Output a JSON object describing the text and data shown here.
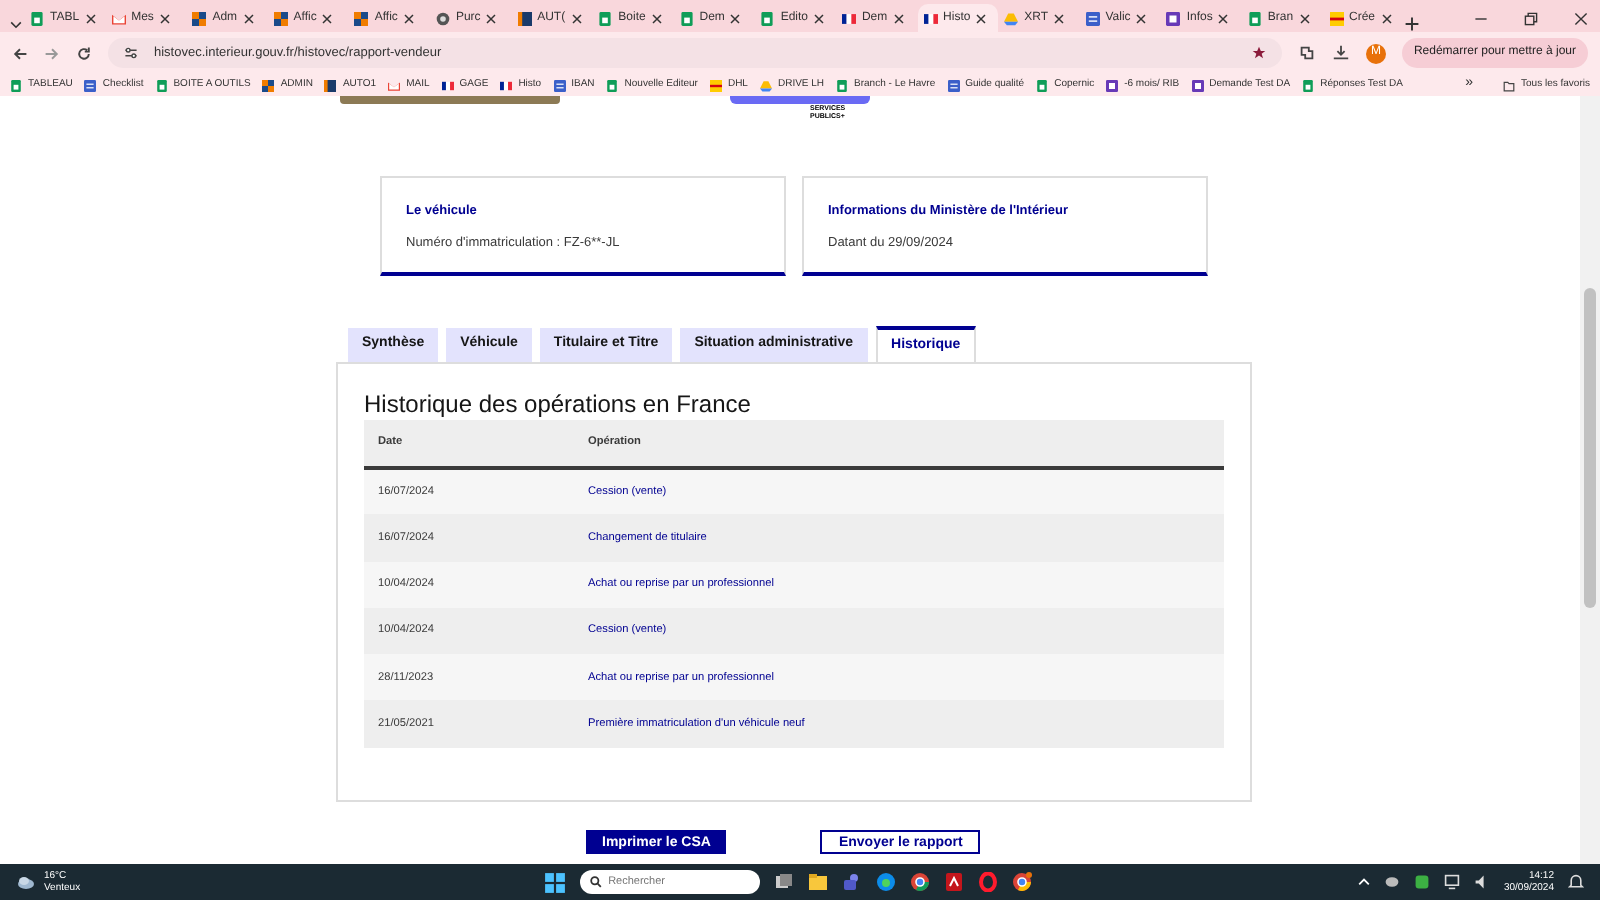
{
  "browser": {
    "tabs": [
      {
        "label": "TABL",
        "kind": "sheets",
        "selected": false
      },
      {
        "label": "Mes",
        "kind": "gmail",
        "selected": false
      },
      {
        "label": "Adm",
        "kind": "orange",
        "selected": false
      },
      {
        "label": "Affic",
        "kind": "orange",
        "selected": false
      },
      {
        "label": "Affic",
        "kind": "orange",
        "selected": false
      },
      {
        "label": "Purc",
        "kind": "globe",
        "selected": false
      },
      {
        "label": "AUT(",
        "kind": "auto",
        "selected": false
      },
      {
        "label": "Boite",
        "kind": "sheets",
        "selected": false
      },
      {
        "label": "Dem",
        "kind": "sheets",
        "selected": false
      },
      {
        "label": "Edito",
        "kind": "sheets",
        "selected": false
      },
      {
        "label": "Dem",
        "kind": "flag",
        "selected": false
      },
      {
        "label": "Histo",
        "kind": "flag",
        "selected": true
      },
      {
        "label": "XRT",
        "kind": "drive",
        "selected": false
      },
      {
        "label": "Valic",
        "kind": "blue",
        "selected": false
      },
      {
        "label": "Infos",
        "kind": "purple",
        "selected": false
      },
      {
        "label": "Bran",
        "kind": "sheets",
        "selected": false
      },
      {
        "label": "Crée",
        "kind": "yellow",
        "selected": false
      }
    ],
    "url": "histovec.interieur.gouv.fr/histovec/rapport-vendeur",
    "avatar": "M",
    "update_button": "Redémarrer pour mettre à jour",
    "bookmarks": [
      {
        "label": "TABLEAU",
        "kind": "sheets"
      },
      {
        "label": "Checklist",
        "kind": "blue"
      },
      {
        "label": "BOITE A OUTILS",
        "kind": "sheets"
      },
      {
        "label": "ADMIN",
        "kind": "orange"
      },
      {
        "label": "AUTO1",
        "kind": "auto"
      },
      {
        "label": "MAIL",
        "kind": "gmail"
      },
      {
        "label": "GAGE",
        "kind": "flag"
      },
      {
        "label": "Histo",
        "kind": "flag"
      },
      {
        "label": "IBAN",
        "kind": "blue"
      },
      {
        "label": "Nouvelle Editeur",
        "kind": "sheets"
      },
      {
        "label": "DHL",
        "kind": "yellow"
      },
      {
        "label": "DRIVE LH",
        "kind": "drive"
      },
      {
        "label": "Branch - Le Havre",
        "kind": "sheets"
      },
      {
        "label": "Guide qualité",
        "kind": "blue"
      },
      {
        "label": "Copernic",
        "kind": "sheets"
      },
      {
        "label": "-6 mois/ RIB",
        "kind": "purple"
      },
      {
        "label": "Demande Test DA",
        "kind": "purple"
      },
      {
        "label": "Réponses Test DA",
        "kind": "sheets"
      }
    ],
    "more_bookmarks": "»",
    "all_bookmarks": "Tous les favoris"
  },
  "page": {
    "logo_text": "SERVICES PUBLICS+",
    "cards": [
      {
        "title": "Le véhicule",
        "text": "Numéro d'immatriculation : FZ-6**-JL"
      },
      {
        "title": "Informations du Ministère de l'Intérieur",
        "text": "Datant du 29/09/2024"
      }
    ],
    "tabs": [
      {
        "label": "Synthèse",
        "selected": false
      },
      {
        "label": "Véhicule",
        "selected": false
      },
      {
        "label": "Titulaire et Titre",
        "selected": false
      },
      {
        "label": "Situation administrative",
        "selected": false
      },
      {
        "label": "Historique",
        "selected": true
      }
    ],
    "section_title": "Historique des opérations en France",
    "table": {
      "columns": [
        "Date",
        "Opération"
      ],
      "rows": [
        [
          "16/07/2024",
          "Cession (vente)"
        ],
        [
          "16/07/2024",
          "Changement de titulaire"
        ],
        [
          "10/04/2024",
          "Achat ou reprise par un professionnel"
        ],
        [
          "10/04/2024",
          "Cession (vente)"
        ],
        [
          "28/11/2023",
          "Achat ou reprise par un professionnel"
        ],
        [
          "21/05/2021",
          "Première immatriculation d'un véhicule neuf"
        ]
      ]
    },
    "buttons": [
      "Imprimer le CSA",
      "Envoyer le rapport"
    ]
  },
  "taskbar": {
    "temperature": "16°C",
    "weather": "Venteux",
    "search_placeholder": "Rechercher",
    "time": "14:12",
    "date": "30/09/2024"
  }
}
